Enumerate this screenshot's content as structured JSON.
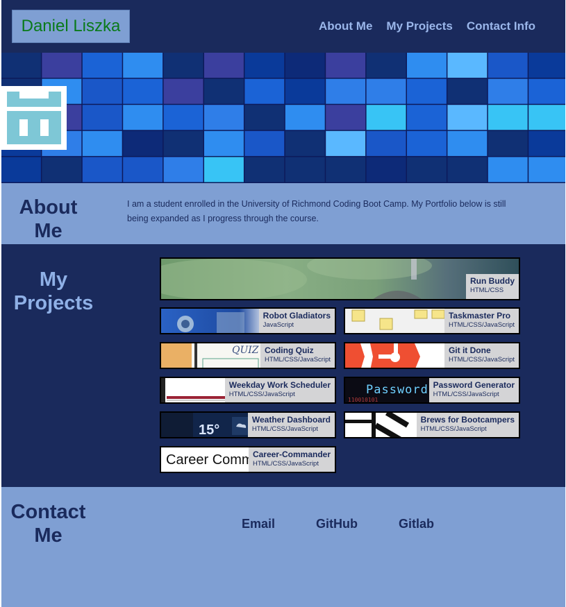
{
  "site": {
    "name": "Daniel Liszka",
    "nav": [
      "About Me",
      "My Projects",
      "Contact Info"
    ]
  },
  "about": {
    "title_line1": "About",
    "title_line2": "Me",
    "text": "I am a student enrolled in the University of Richmond Coding Boot Camp. My Portfolio below is still being expanded as I progress through the course."
  },
  "projects": {
    "title_line1": "My",
    "title_line2": "Projects",
    "items": [
      {
        "name": "Run Buddy",
        "tech": "HTML/CSS"
      },
      {
        "name": "Robot Gladiators",
        "tech": "JavaScript"
      },
      {
        "name": "Taskmaster Pro",
        "tech": "HTML/CSS/JavaScript"
      },
      {
        "name": "Coding Quiz",
        "tech": "HTML/CSS/JavaScript"
      },
      {
        "name": "Git it Done",
        "tech": "HTML/CSS/JavaScript"
      },
      {
        "name": "Weekday Work Scheduler",
        "tech": "HTML/CSS/JavaScript"
      },
      {
        "name": "Password Generator",
        "tech": "HTML/CSS/JavaScript"
      },
      {
        "name": "Weather Dashboard",
        "tech": "HTML/CSS/JavaScript"
      },
      {
        "name": "Brews for Bootcampers",
        "tech": "HTML/CSS/JavaScript"
      },
      {
        "name": "Career-Commander",
        "tech": "HTML/CSS/JavaScript"
      }
    ],
    "thumb_text": {
      "quiz": "QUIZ",
      "password": "Password",
      "password_bits": "110010101",
      "weather_temp": "15°",
      "career": "Career Comm"
    }
  },
  "contact": {
    "title_line1": "Contact",
    "title_line2": "Me",
    "links": [
      "Email",
      "GitHub",
      "Gitlab"
    ]
  },
  "colors": {
    "navy": "#1a2a5c",
    "periwinkle": "#7f9fd3",
    "brand_green": "#0a7a1a",
    "nav_link": "#9ab6ea",
    "caption_bg": "#d4d4d6"
  }
}
